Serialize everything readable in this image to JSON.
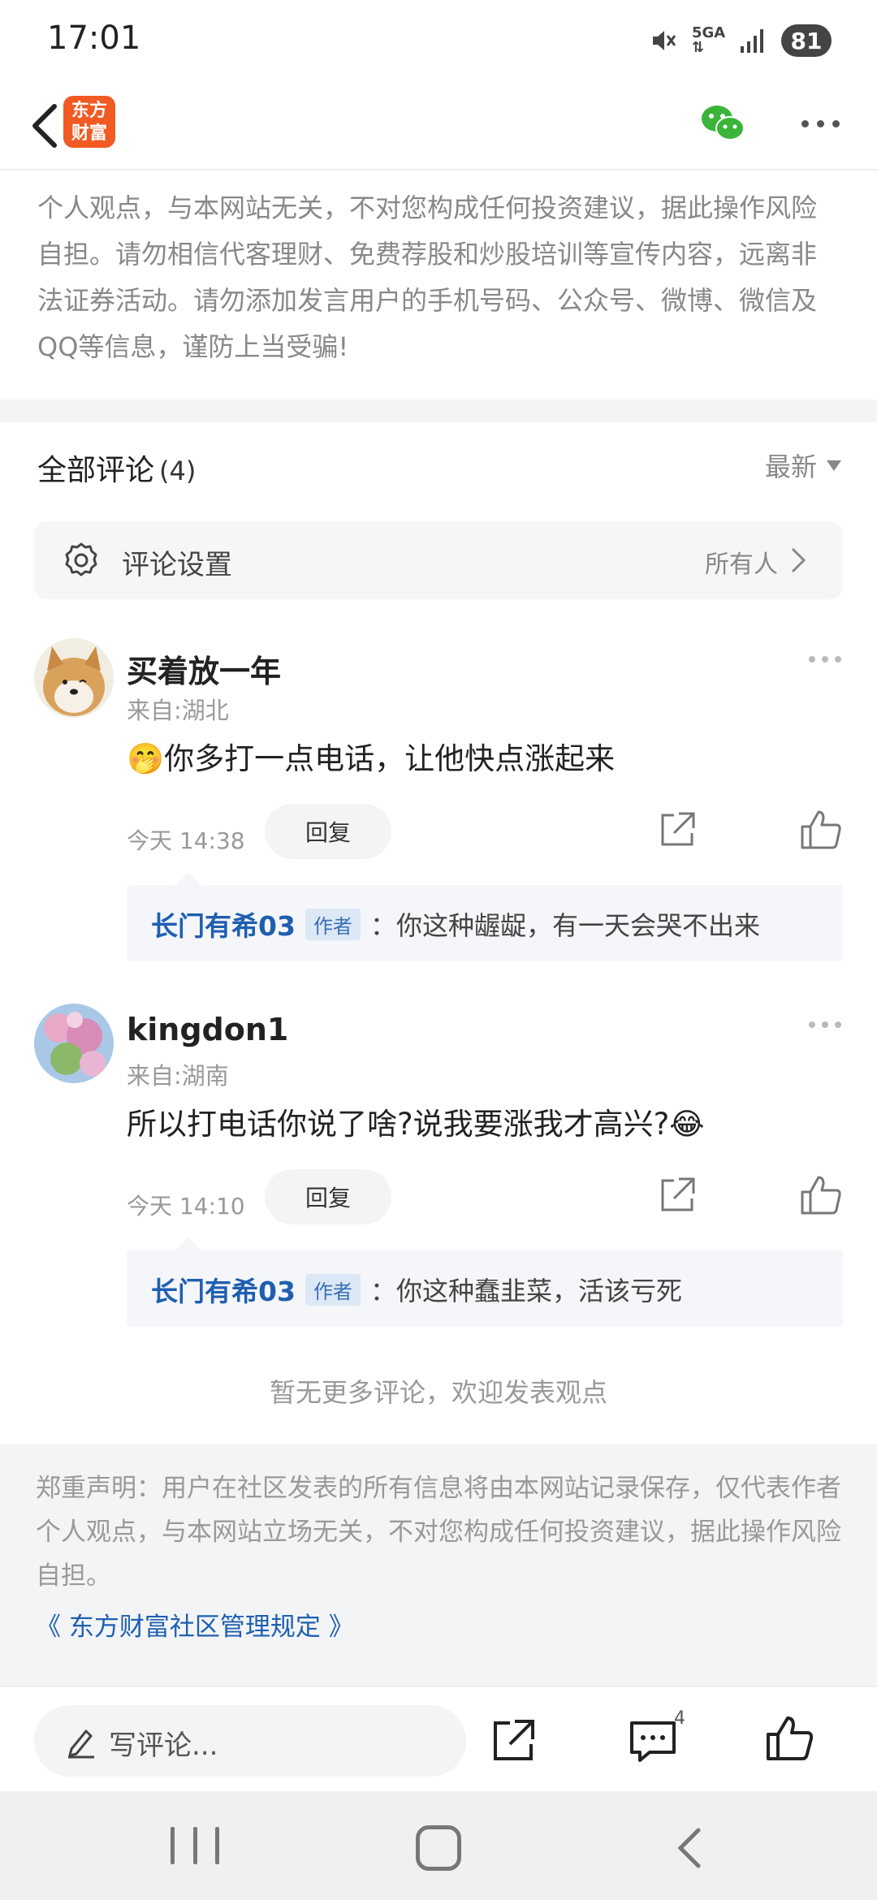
{
  "status_bar": {
    "time": "17:01",
    "network": "5GA",
    "battery": "81"
  },
  "header": {
    "logo_text_line1": "东方",
    "logo_text_line2": "财富",
    "icons": [
      "back-icon",
      "wechat-icon",
      "more-icon"
    ]
  },
  "disclaimer_top": {
    "lines": [
      "个人观点，与本网站无关，不对您构成任何投资建议，据此操作风险",
      "自担。请勿相信代客理财、免费荐股和炒股培训等宣传内容，远离非",
      "法证券活动。请勿添加发言用户的手机号码、公众号、微博、微信及",
      "QQ等信息，谨防上当受骗!"
    ]
  },
  "comments_section": {
    "title": "全部评论",
    "count": "(4)",
    "sort_label": "最新",
    "settings_label": "评论设置",
    "settings_value": "所有人"
  },
  "comments": [
    {
      "name": "买着放一年",
      "location": "来自:湖北",
      "text": "🤭你多打一点电话，让他快点涨起来",
      "time": "今天 14:38",
      "reply_label": "回复",
      "reply": {
        "author": "长门有希03",
        "tag": "作者",
        "sep": "：",
        "text": "你这种龌龊，有一天会哭不出来"
      }
    },
    {
      "name": "kingdon1",
      "location": "来自:湖南",
      "text": "所以打电话你说了啥?说我要涨我才高兴?😂",
      "time": "今天 14:10",
      "reply_label": "回复",
      "reply": {
        "author": "长门有希03",
        "tag": "作者",
        "sep": "：",
        "text": "你这种蠢韭菜，活该亏死"
      }
    }
  ],
  "no_more_text": "暂无更多评论，欢迎发表观点",
  "footer": {
    "notice": "郑重声明：用户在社区发表的所有信息将由本网站记录保存，仅代表作者个人观点，与本网站立场无关，不对您构成任何投资建议，据此操作风险自担。",
    "link": "《 东方财富社区管理规定 》"
  },
  "bottom_bar": {
    "input_placeholder": "写评论...",
    "comment_count": "4"
  },
  "colors": {
    "brand": "#f15a22",
    "link": "#1f5fb0",
    "muted": "#999999",
    "wechat": "#3ab53a"
  }
}
